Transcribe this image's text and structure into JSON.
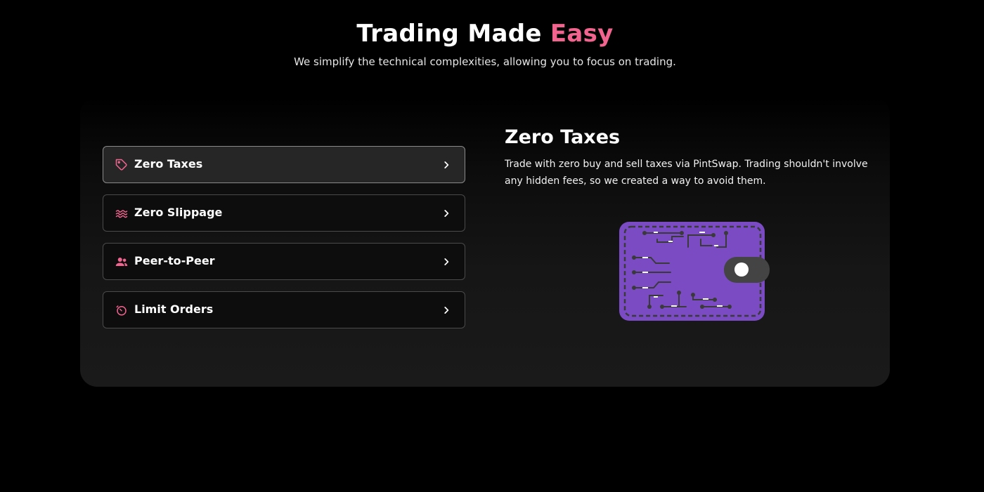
{
  "header": {
    "title_main": "Trading Made",
    "title_accent": "Easy",
    "subtitle": "We simplify the technical complexities, allowing you to focus on trading."
  },
  "features": [
    {
      "label": "Zero Taxes",
      "icon": "tag-icon",
      "active": true
    },
    {
      "label": "Zero Slippage",
      "icon": "waves-icon",
      "active": false
    },
    {
      "label": "Peer-to-Peer",
      "icon": "users-icon",
      "active": false
    },
    {
      "label": "Limit Orders",
      "icon": "timer-icon",
      "active": false
    }
  ],
  "detail": {
    "title": "Zero Taxes",
    "description": "Trade with zero buy and sell taxes via PintSwap. Trading shouldn't involve any hidden fees, so we created a way to avoid them.",
    "illustration": "wallet-circuit-illustration"
  },
  "colors": {
    "accent": "#f0648f",
    "background": "#000000",
    "wallet_purple": "#7b4bc4",
    "wallet_lines": "#3a3a3a"
  }
}
